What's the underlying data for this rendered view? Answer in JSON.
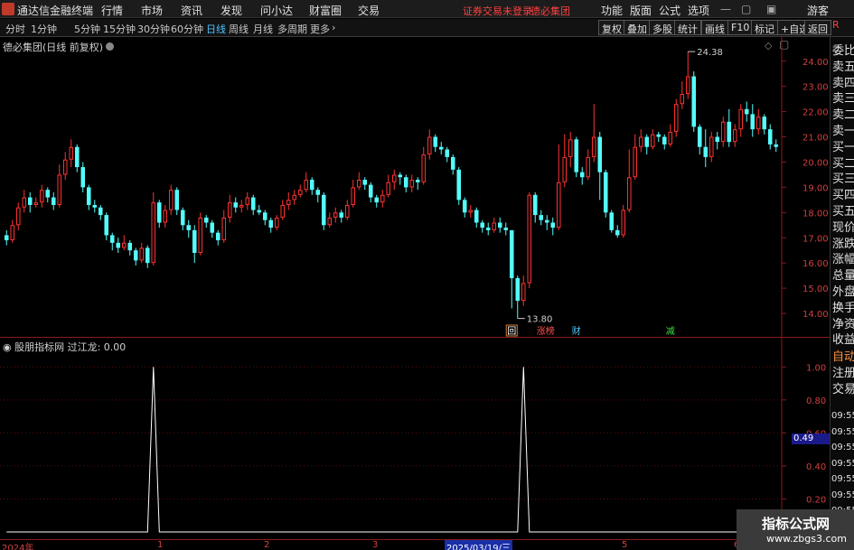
{
  "menubar": {
    "app_title": "通达信金融终端",
    "items": [
      "行情",
      "市场",
      "资讯",
      "发现",
      "问小达",
      "财富圈",
      "交易"
    ],
    "status_text": "证券交易未登录",
    "stock_name": "德必集团",
    "right_items": [
      "功能",
      "版面",
      "公式",
      "选项"
    ],
    "user": "游客"
  },
  "toolbar": {
    "periods": [
      "分时",
      "1分钟",
      "5分钟",
      "15分钟",
      "30分钟",
      "60分钟",
      "日线",
      "周线",
      "月线",
      "多周期",
      "更多"
    ],
    "active_period": "日线",
    "buttons": [
      "复权",
      "叠加",
      "多股",
      "统计",
      "画线",
      "F10",
      "标记",
      "+自选",
      "返回"
    ]
  },
  "main_chart": {
    "title": "德必集团(日线 前复权)",
    "y_ticks": [
      "24.00",
      "23.00",
      "22.00",
      "21.00",
      "20.00",
      "19.00",
      "18.00",
      "17.00",
      "16.00",
      "15.00",
      "14.00"
    ],
    "high_label": "24.38",
    "low_label": "13.80",
    "markers": [
      {
        "text": "回",
        "color": "#ffffff"
      },
      {
        "text": "涨榜",
        "color": "#ff5050"
      },
      {
        "text": "财",
        "color": "#4dc3ff"
      },
      {
        "text": "减",
        "color": "#40e040"
      }
    ]
  },
  "indicator": {
    "title": "股朋指标网 过江龙: 0.00",
    "y_ticks": [
      "1.00",
      "0.80",
      "0.60",
      "0.40",
      "0.20"
    ],
    "current_value": "0.49"
  },
  "date_axis": {
    "labels": [
      "2024年",
      "1",
      "2",
      "3",
      "2025/03/19/三",
      "5",
      "6"
    ],
    "selected": "2025/03/19/三"
  },
  "right_panel": {
    "items": [
      "委比",
      "卖五",
      "卖四",
      "卖三",
      "卖二",
      "卖一",
      "买一",
      "买二",
      "买三",
      "买四",
      "买五",
      "现价",
      "涨跌",
      "涨幅",
      "总量",
      "外盘",
      "换手",
      "净资",
      "收益",
      "自动",
      "注册",
      "交易"
    ],
    "times": [
      "09:55",
      "09:55",
      "09:55",
      "09:55",
      "09:55",
      "09:55",
      "09:55",
      "09:55",
      "09:55"
    ]
  },
  "watermark": {
    "line1": "指标公式网",
    "line2": "www.zbgs3.com"
  },
  "chart_data": {
    "type": "candlestick",
    "ylim": [
      13.5,
      24.6
    ],
    "indicator_ylim": [
      0,
      1.1
    ],
    "colors": {
      "up": "#ff3232",
      "down": "#54fcfc"
    },
    "candles": [
      [
        17.1,
        16.9,
        17.3,
        16.7
      ],
      [
        16.9,
        17.5,
        17.7,
        16.8
      ],
      [
        17.5,
        18.2,
        18.4,
        17.3
      ],
      [
        18.2,
        18.6,
        18.9,
        18.0
      ],
      [
        18.6,
        18.3,
        18.8,
        18.0
      ],
      [
        18.3,
        18.4,
        18.6,
        18.2
      ],
      [
        18.4,
        18.9,
        19.1,
        18.2
      ],
      [
        18.9,
        18.6,
        19.0,
        18.4
      ],
      [
        18.6,
        18.3,
        18.8,
        18.1
      ],
      [
        18.3,
        19.5,
        19.9,
        18.2
      ],
      [
        19.5,
        20.1,
        20.4,
        19.3
      ],
      [
        20.1,
        20.6,
        20.9,
        19.8
      ],
      [
        20.6,
        19.8,
        20.7,
        19.6
      ],
      [
        19.8,
        19.0,
        20.0,
        18.8
      ],
      [
        19.0,
        18.3,
        19.1,
        18.1
      ],
      [
        18.3,
        18.2,
        18.5,
        18.0
      ],
      [
        18.2,
        17.9,
        18.3,
        17.7
      ],
      [
        17.9,
        17.1,
        18.0,
        16.9
      ],
      [
        17.1,
        16.8,
        17.2,
        16.5
      ],
      [
        16.8,
        16.6,
        17.0,
        16.4
      ],
      [
        16.6,
        16.8,
        17.1,
        16.5
      ],
      [
        16.8,
        16.5,
        16.9,
        16.3
      ],
      [
        16.5,
        16.1,
        16.6,
        15.9
      ],
      [
        16.1,
        16.6,
        16.8,
        16.0
      ],
      [
        16.6,
        16.0,
        16.7,
        15.8
      ],
      [
        16.0,
        18.4,
        18.8,
        15.9
      ],
      [
        18.4,
        17.6,
        18.5,
        17.4
      ],
      [
        17.6,
        18.1,
        18.3,
        17.4
      ],
      [
        18.1,
        18.9,
        19.1,
        17.9
      ],
      [
        18.9,
        18.1,
        19.0,
        17.9
      ],
      [
        18.1,
        17.5,
        18.2,
        17.3
      ],
      [
        17.5,
        17.3,
        17.7,
        17.0
      ],
      [
        17.3,
        16.4,
        17.5,
        16.0
      ],
      [
        16.4,
        17.8,
        18.0,
        16.3
      ],
      [
        17.8,
        17.6,
        17.9,
        17.4
      ],
      [
        17.6,
        17.2,
        17.7,
        17.0
      ],
      [
        17.2,
        16.9,
        17.3,
        16.7
      ],
      [
        16.9,
        17.8,
        18.1,
        16.8
      ],
      [
        17.8,
        18.4,
        18.7,
        17.6
      ],
      [
        18.4,
        18.2,
        18.6,
        18.0
      ],
      [
        18.2,
        18.3,
        18.5,
        18.0
      ],
      [
        18.3,
        18.6,
        18.8,
        18.1
      ],
      [
        18.6,
        18.1,
        18.7,
        17.9
      ],
      [
        18.1,
        18.0,
        18.3,
        17.9
      ],
      [
        18.0,
        17.7,
        18.1,
        17.5
      ],
      [
        17.7,
        17.4,
        17.8,
        17.2
      ],
      [
        17.4,
        17.8,
        17.9,
        17.3
      ],
      [
        17.8,
        18.3,
        18.5,
        17.7
      ],
      [
        18.3,
        18.5,
        18.8,
        18.1
      ],
      [
        18.5,
        18.7,
        18.9,
        18.3
      ],
      [
        18.7,
        18.9,
        19.1,
        18.6
      ],
      [
        18.9,
        19.3,
        19.6,
        18.8
      ],
      [
        19.3,
        18.9,
        19.4,
        18.7
      ],
      [
        18.9,
        18.7,
        19.0,
        18.4
      ],
      [
        18.7,
        17.5,
        18.8,
        17.3
      ],
      [
        17.5,
        17.8,
        18.0,
        17.4
      ],
      [
        17.8,
        18.0,
        18.2,
        17.6
      ],
      [
        18.0,
        17.8,
        18.1,
        17.6
      ],
      [
        17.8,
        18.3,
        18.5,
        17.7
      ],
      [
        18.3,
        19.0,
        19.3,
        18.2
      ],
      [
        19.0,
        19.3,
        19.6,
        18.9
      ],
      [
        19.3,
        19.1,
        19.4,
        18.9
      ],
      [
        19.1,
        18.6,
        19.2,
        18.4
      ],
      [
        18.6,
        18.4,
        18.7,
        18.2
      ],
      [
        18.4,
        18.7,
        18.9,
        18.2
      ],
      [
        18.7,
        19.2,
        19.5,
        18.6
      ],
      [
        19.2,
        19.5,
        19.7,
        18.9
      ],
      [
        19.5,
        19.4,
        19.6,
        19.1
      ],
      [
        19.4,
        19.0,
        19.5,
        18.8
      ],
      [
        19.0,
        19.3,
        19.5,
        18.8
      ],
      [
        19.3,
        19.2,
        19.4,
        18.9
      ],
      [
        19.2,
        20.3,
        20.6,
        19.1
      ],
      [
        20.3,
        21.0,
        21.3,
        20.1
      ],
      [
        21.0,
        20.6,
        21.1,
        20.4
      ],
      [
        20.6,
        20.5,
        20.8,
        20.3
      ],
      [
        20.5,
        20.2,
        20.6,
        20.0
      ],
      [
        20.2,
        19.7,
        20.3,
        19.5
      ],
      [
        19.7,
        18.5,
        19.8,
        18.3
      ],
      [
        18.5,
        18.0,
        18.6,
        17.8
      ],
      [
        18.0,
        18.1,
        18.3,
        17.8
      ],
      [
        18.1,
        17.6,
        18.2,
        17.4
      ],
      [
        17.6,
        17.4,
        17.7,
        17.2
      ],
      [
        17.4,
        17.3,
        17.6,
        17.1
      ],
      [
        17.3,
        17.6,
        17.8,
        17.2
      ],
      [
        17.6,
        17.4,
        17.8,
        17.2
      ],
      [
        17.4,
        17.3,
        17.6,
        17.1
      ],
      [
        17.3,
        15.4,
        16.5,
        14.2
      ],
      [
        15.4,
        14.5,
        15.5,
        13.8
      ],
      [
        14.5,
        15.2,
        15.5,
        14.3
      ],
      [
        15.2,
        18.7,
        18.8,
        15.0
      ],
      [
        18.7,
        17.9,
        18.8,
        17.6
      ],
      [
        17.9,
        17.7,
        18.1,
        17.5
      ],
      [
        17.7,
        17.6,
        17.9,
        17.3
      ],
      [
        17.6,
        17.4,
        17.8,
        17.1
      ],
      [
        17.4,
        19.2,
        20.7,
        17.3
      ],
      [
        19.2,
        20.2,
        21.1,
        19.0
      ],
      [
        20.2,
        20.9,
        21.2,
        19.8
      ],
      [
        20.9,
        19.6,
        21.0,
        19.4
      ],
      [
        19.6,
        19.4,
        19.8,
        19.1
      ],
      [
        19.4,
        20.2,
        20.5,
        19.3
      ],
      [
        20.2,
        21.0,
        22.3,
        20.0
      ],
      [
        21.0,
        19.6,
        21.2,
        18.5
      ],
      [
        19.6,
        18.0,
        19.7,
        17.8
      ],
      [
        18.0,
        17.3,
        18.1,
        17.2
      ],
      [
        17.3,
        17.1,
        17.5,
        17.0
      ],
      [
        17.1,
        18.1,
        18.3,
        17.0
      ],
      [
        18.1,
        19.4,
        20.5,
        18.0
      ],
      [
        19.4,
        20.6,
        21.1,
        19.3
      ],
      [
        20.6,
        21.0,
        21.3,
        20.4
      ],
      [
        21.0,
        20.6,
        21.1,
        20.3
      ],
      [
        20.6,
        21.1,
        21.3,
        20.5
      ],
      [
        21.1,
        21.0,
        21.2,
        20.8
      ],
      [
        21.0,
        20.7,
        21.1,
        20.5
      ],
      [
        20.7,
        21.2,
        21.5,
        20.6
      ],
      [
        21.2,
        22.3,
        22.5,
        21.0
      ],
      [
        22.3,
        22.7,
        23.2,
        22.1
      ],
      [
        22.7,
        23.4,
        24.38,
        22.5
      ],
      [
        23.4,
        21.4,
        23.6,
        21.2
      ],
      [
        21.4,
        20.6,
        21.5,
        20.3
      ],
      [
        20.6,
        20.2,
        21.3,
        19.8
      ],
      [
        20.2,
        21.0,
        21.2,
        20.0
      ],
      [
        21.0,
        20.8,
        21.2,
        20.5
      ],
      [
        20.8,
        21.6,
        21.8,
        20.6
      ],
      [
        21.6,
        20.8,
        22.1,
        20.6
      ],
      [
        20.8,
        21.3,
        21.5,
        20.6
      ],
      [
        21.3,
        22.1,
        22.3,
        21.0
      ],
      [
        22.1,
        21.9,
        22.4,
        21.6
      ],
      [
        21.9,
        21.3,
        22.3,
        21.0
      ],
      [
        21.3,
        21.8,
        22.1,
        21.1
      ],
      [
        21.8,
        21.3,
        21.9,
        21.1
      ],
      [
        21.3,
        20.7,
        21.5,
        20.5
      ],
      [
        20.7,
        20.6,
        20.9,
        20.4
      ]
    ],
    "indicator_spikes": [
      {
        "index": 25,
        "value": 1.0
      },
      {
        "index": 88,
        "value": 1.0
      }
    ],
    "marker_indices": [
      86,
      91,
      97,
      113
    ]
  }
}
